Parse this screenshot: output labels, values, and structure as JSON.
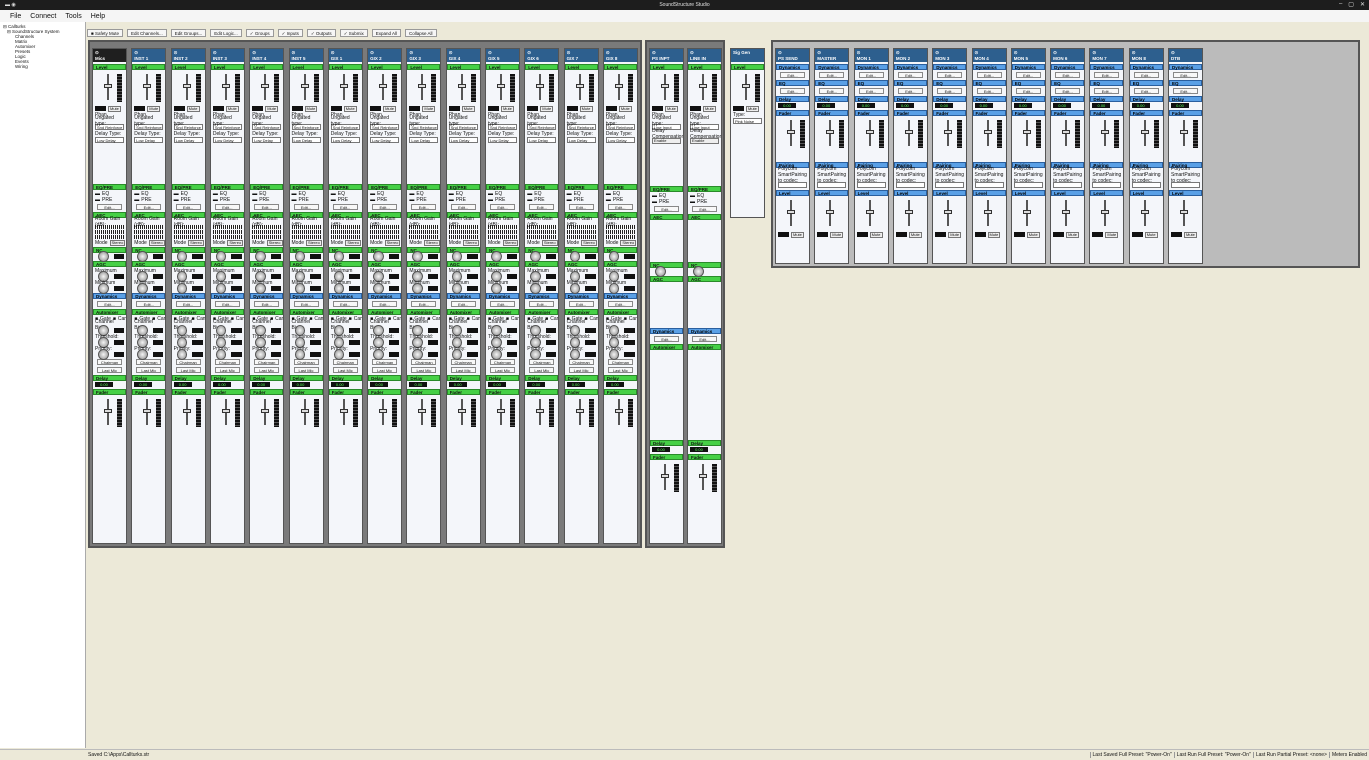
{
  "titlebar": {
    "title": "SoundStructure Studio",
    "window_controls": [
      "–",
      "▢",
      "✕"
    ]
  },
  "menu": [
    "File",
    "Connect",
    "Tools",
    "Help"
  ],
  "tree": {
    "root": "Callturks",
    "system": "SoundStructure System",
    "items": [
      "Channels",
      "Matrix",
      "Automixer",
      "Presets",
      "Logic",
      "Events",
      "Wiring"
    ]
  },
  "toolbar": {
    "safety_mute": "Safety Mute",
    "edit_channels": "Edit Channels...",
    "edit_groups": "Edit Groups...",
    "edit_logic": "Edit Logic...",
    "groups": "Groups",
    "inputs": "Inputs",
    "outputs": "Outputs",
    "submix": "Submix",
    "expand_all": "Expand All",
    "collapse_all": "Collapse All"
  },
  "inputs": {
    "channels": [
      "Mics",
      "INST 1",
      "INST 2",
      "INST 3",
      "INST 4",
      "INST 5",
      "GIX 1",
      "GIX 2",
      "GIX 3",
      "GIX 4",
      "GIX 5",
      "GIX 6",
      "GIX 7",
      "GIX 8"
    ]
  },
  "lines": {
    "channels": [
      "PS INPT",
      "LINE IN"
    ]
  },
  "siggen": {
    "name": "Sig Gen",
    "type_label": "Type:",
    "type_value": "Pink Noise"
  },
  "outputs": {
    "channels": [
      "PS SEND",
      "MASTER",
      "MON 1",
      "MON 2",
      "MON 3",
      "MON 4",
      "MON 5",
      "MON 6",
      "MON 7",
      "MON 8",
      "DTB"
    ]
  },
  "labels": {
    "level": "Level",
    "plus": "+20",
    "zero": "0",
    "minus": "-100",
    "mute": "Mute",
    "phan": "Phan.",
    "ungated": "Ungated type:",
    "ungated_value": "Snd Reinforce",
    "delay_type": "Delay Type:",
    "delay_value": "Low Delay",
    "eqpre": "EQ/PRE",
    "eq": "EQ",
    "pre": "PRE",
    "edit": "Edit...",
    "aec": "AEC",
    "room_gain": "Room Gain (dB):",
    "mode": "Mode",
    "mode_value": "Stereo",
    "nc": "NC",
    "agc": "AGC",
    "maximum": "Maximum",
    "minimum": "Minimum",
    "dynamics": "Dynamics",
    "automixer": "Automixer",
    "gate": "Gate",
    "cam": "Cam",
    "chan_bias": "Channel Bias:",
    "threshold": "Threshold:",
    "priority": "Priority:",
    "chairman": "Chairman",
    "last_mic": "Last Mic",
    "delay": "Delay",
    "delay_value_ms": "0.00",
    "fader": "Fader",
    "pairing": "Pairing",
    "polycom": "Polycom SmartPairing to codec:",
    "line_input": "Line Input",
    "line_input_type": "Line Input",
    "delay_comp": "Delay Compensation:",
    "enable": "Enable"
  },
  "status": {
    "saved": "Saved C:\\Apps\\Callturks.str",
    "last_full": "Last Saved Full Preset: \"Power-On\"",
    "last_run_full": "Last Run Full Preset: \"Power-On\"",
    "last_run_partial": "Last Run Partial Preset: <none>",
    "meters": "Meters Enabled"
  }
}
